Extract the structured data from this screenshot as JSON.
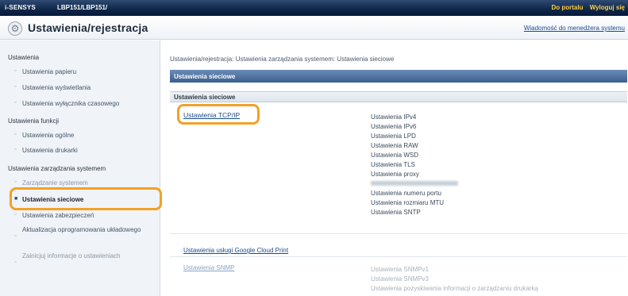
{
  "topbar": {
    "brand": "i-SENSYS",
    "model": "LBP151/LBP151/",
    "portal": "Do portalu",
    "logout": "Wyloguj się"
  },
  "header": {
    "title": "Ustawienia/rejestracja",
    "admin_message": "Wiadomość do menedżera systemu"
  },
  "sidebar": {
    "groups": [
      {
        "heading": "Ustawienia",
        "items": [
          {
            "label": "Ustawienia papieru"
          },
          {
            "label": "Ustawienia wyświetlania"
          },
          {
            "label": "Ustawienia wyłącznika czasowego"
          }
        ]
      },
      {
        "heading": "Ustawienia funkcji",
        "items": [
          {
            "label": "Ustawienia ogólne"
          },
          {
            "label": "Ustawienia drukarki"
          }
        ]
      },
      {
        "heading": "Ustawienia zarządzania systemem",
        "items": [
          {
            "label": "Zarządzanie systemem"
          },
          {
            "label": "Ustawienia sieciowe"
          },
          {
            "label": "Ustawienia zabezpieczeń"
          },
          {
            "label": "Aktualizacja oprogramowania układowego"
          },
          {
            "label": "Zainicjuj informacje o ustawieniach"
          }
        ]
      }
    ]
  },
  "main": {
    "breadcrumb": "Ustawienia/rejestracja: Ustawienia zarządzania systemem: Ustawienia sieciowe",
    "section_title": "Ustawienia sieciowe",
    "subsection_title": "Ustawienia sieciowe",
    "links": {
      "tcpip": "Ustawienia TCP/IP",
      "google_cloud": "Ustawienia usługi Google Cloud Print",
      "snmp": "Ustawienia SNMP"
    },
    "tcpip_details": [
      "Ustawienia IPv4",
      "Ustawienia IPv6",
      "Ustawienia LPD",
      "Ustawienia RAW",
      "Ustawienia WSD",
      "Ustawienia TLS",
      "Ustawienia proxy",
      "",
      "Ustawienia numeru portu",
      "Ustawienia rozmiaru MTU",
      "Ustawienia SNTP"
    ],
    "snmp_details": [
      "Ustawienia SNMPv1",
      "Ustawienia SNMPv3",
      "Ustawienia pozyskiwania informacji o zarządzaniu drukarką"
    ]
  },
  "colors": {
    "topbar": "#0f2748",
    "section_bar": "#3a5f8f",
    "highlight": "#f2a128",
    "link": "#1b4c8c"
  }
}
